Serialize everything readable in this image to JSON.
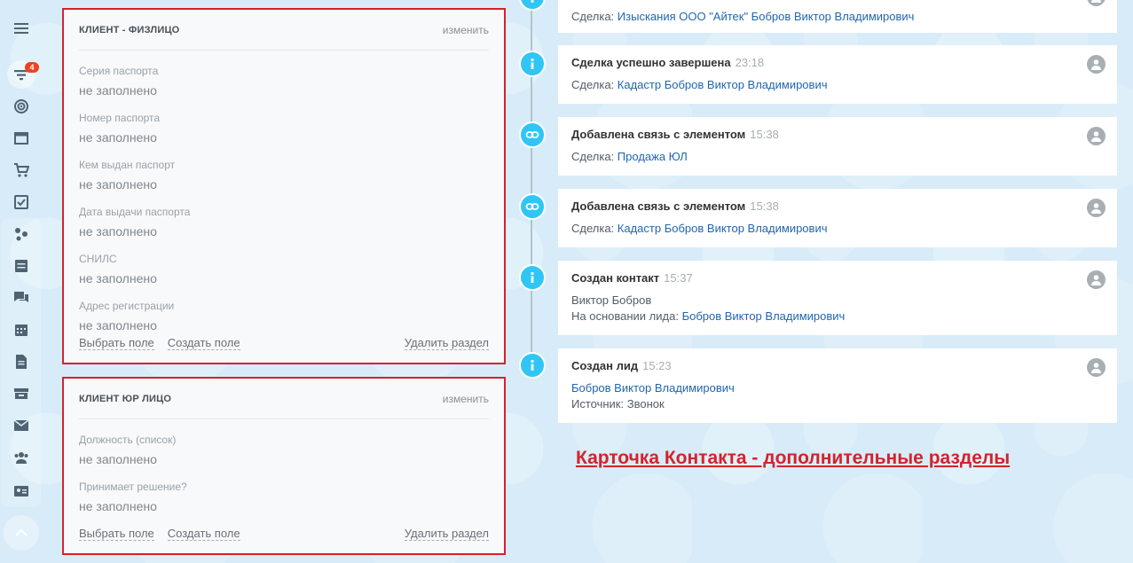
{
  "sidebar": {
    "badge": "4",
    "icons": [
      "menu-icon",
      "filter-icon",
      "target-icon",
      "window-icon",
      "cart-icon",
      "task-icon",
      "sites-icon",
      "list-icon",
      "chat-icon",
      "calendar-icon",
      "document-icon",
      "store-icon",
      "mail-icon",
      "users-icon",
      "contact-card-icon",
      "scroll-up-icon"
    ]
  },
  "panels": [
    {
      "title": "КЛИЕНТ - ФИЗЛИЦО",
      "edit": "изменить",
      "fields": [
        {
          "label": "Серия паспорта",
          "value": "не заполнено"
        },
        {
          "label": "Номер паспорта",
          "value": "не заполнено"
        },
        {
          "label": "Кем выдан паспорт",
          "value": "не заполнено"
        },
        {
          "label": "Дата выдачи паспорта",
          "value": "не заполнено"
        },
        {
          "label": "СНИЛС",
          "value": "не заполнено"
        },
        {
          "label": "Адрес регистрации",
          "value": "не заполнено"
        }
      ],
      "select_field": "Выбрать поле",
      "create_field": "Создать поле",
      "delete_section": "Удалить раздел"
    },
    {
      "title": "КЛИЕНТ ЮР ЛИЦО",
      "edit": "изменить",
      "fields": [
        {
          "label": "Должность (список)",
          "value": "не заполнено"
        },
        {
          "label": "Принимает решение?",
          "value": "не заполнено"
        }
      ],
      "select_field": "Выбрать поле",
      "create_field": "Создать поле",
      "delete_section": "Удалить раздел"
    }
  ],
  "timeline": [
    {
      "icon": "info-icon",
      "title": "",
      "time": "",
      "lines": [
        {
          "prefix": "Сделка: ",
          "link": "Изыскания ООО \"Айтек\" Бобров Виктор Владимирович"
        }
      ]
    },
    {
      "icon": "info-icon",
      "title": "Сделка успешно завершена",
      "time": "23:18",
      "lines": [
        {
          "prefix": "Сделка: ",
          "link": "Кадастр Бобров Виктор Владимирович"
        }
      ]
    },
    {
      "icon": "link-icon",
      "title": "Добавлена связь с элементом",
      "time": "15:38",
      "lines": [
        {
          "prefix": "Сделка: ",
          "link": "Продажа ЮЛ"
        }
      ]
    },
    {
      "icon": "link-icon",
      "title": "Добавлена связь с элементом",
      "time": "15:38",
      "lines": [
        {
          "prefix": "Сделка: ",
          "link": "Кадастр Бобров Виктор Владимирович"
        }
      ]
    },
    {
      "icon": "info-icon",
      "title": "Создан контакт",
      "time": "15:37",
      "lines": [
        {
          "prefix": "Виктор Бобров",
          "link": ""
        },
        {
          "prefix": "На основании лида: ",
          "link": "Бобров Виктор Владимирович"
        }
      ]
    },
    {
      "icon": "info-icon",
      "title": "Создан лид",
      "time": "15:23",
      "lines": [
        {
          "prefix": "",
          "link": "Бобров Виктор Владимирович"
        },
        {
          "prefix": "Источник: Звонок",
          "link": ""
        }
      ]
    }
  ],
  "caption": "Карточка Контакта - дополнительные разделы"
}
